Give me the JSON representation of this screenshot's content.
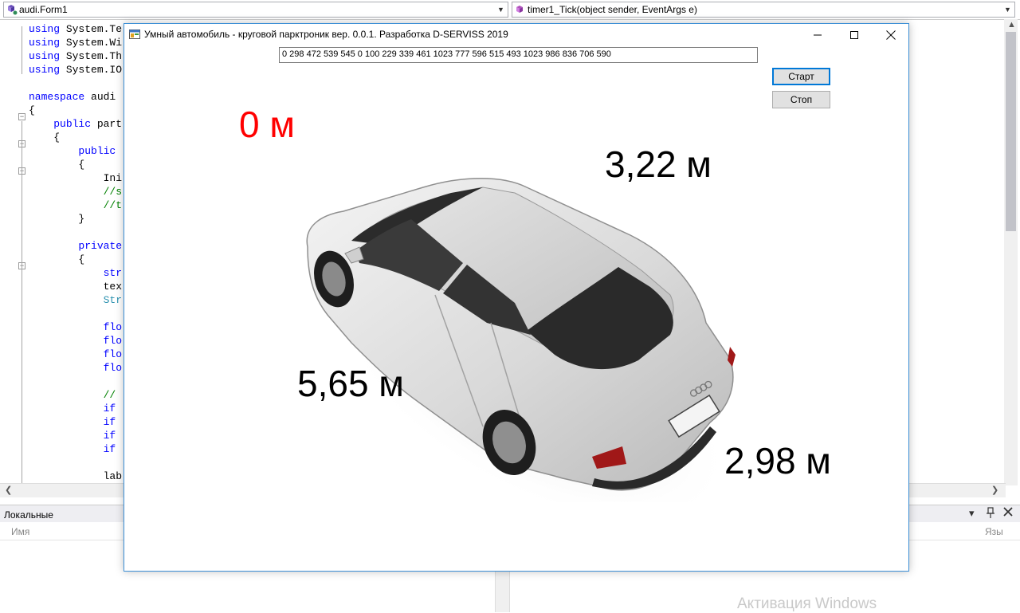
{
  "ide": {
    "left_combo": "audi.Form1",
    "right_combo": "timer1_Tick(object sender, EventArgs e)",
    "code_lines": [
      "using System.Te",
      "using System.Wi",
      "using System.Th",
      "using System.IO",
      "",
      "namespace audi",
      "{",
      "    public part",
      "    {",
      "        public ",
      "        {",
      "            Ini",
      "            //s",
      "            //t",
      "        }",
      "",
      "        private",
      "        {",
      "            str",
      "            tex",
      "            Str",
      "",
      "            flo",
      "            flo",
      "            flo",
      "            flo",
      "",
      "            // ",
      "            if ",
      "            if ",
      "            if ",
      "            if ",
      "",
      "            lab"
    ],
    "locals_title": "Локальные",
    "locals_col_name": "Имя",
    "locals_col_lang": "Язы",
    "watermark": "Активация Windows"
  },
  "form": {
    "title": "Умный автомобиль - круговой парктроник вер. 0.0.1. Разработка D-SERVISS 2019",
    "data_text": "0 298 472 539 545 0 100 229 339 461 1023 777 596 515 493 1023 986 836 706 590",
    "start_label": "Старт",
    "stop_label": "Стоп",
    "distances": {
      "front_left": "0 м",
      "front_right": "3,22 м",
      "rear_left": "5,65 м",
      "rear_right": "2,98 м"
    }
  },
  "colors": {
    "alert": "#ff0000",
    "window_border": "#3c8fd6",
    "keyword": "#0000ff",
    "comment": "#008000",
    "type": "#2b91af"
  }
}
